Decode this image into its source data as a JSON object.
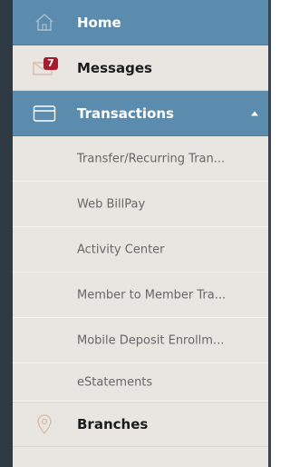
{
  "menu": {
    "home": {
      "label": "Home",
      "icon": "home-icon"
    },
    "messages": {
      "label": "Messages",
      "icon": "envelope-icon",
      "badge": "7"
    },
    "transactions": {
      "label": "Transactions",
      "icon": "card-icon",
      "expanded": true,
      "submenu": [
        {
          "label": "Transfer/Recurring Tran..."
        },
        {
          "label": "Web BillPay"
        },
        {
          "label": "Activity Center"
        },
        {
          "label": "Member to Member Tra..."
        },
        {
          "label": "Mobile Deposit Enrollm..."
        },
        {
          "label": "eStatements"
        }
      ]
    },
    "branches": {
      "label": "Branches",
      "icon": "location-pin-icon"
    }
  },
  "colors": {
    "active_background": "#5b8bad",
    "menu_background": "#e9e6e2",
    "badge": "#a51d2d",
    "icon_muted": "#d8b9a9"
  }
}
